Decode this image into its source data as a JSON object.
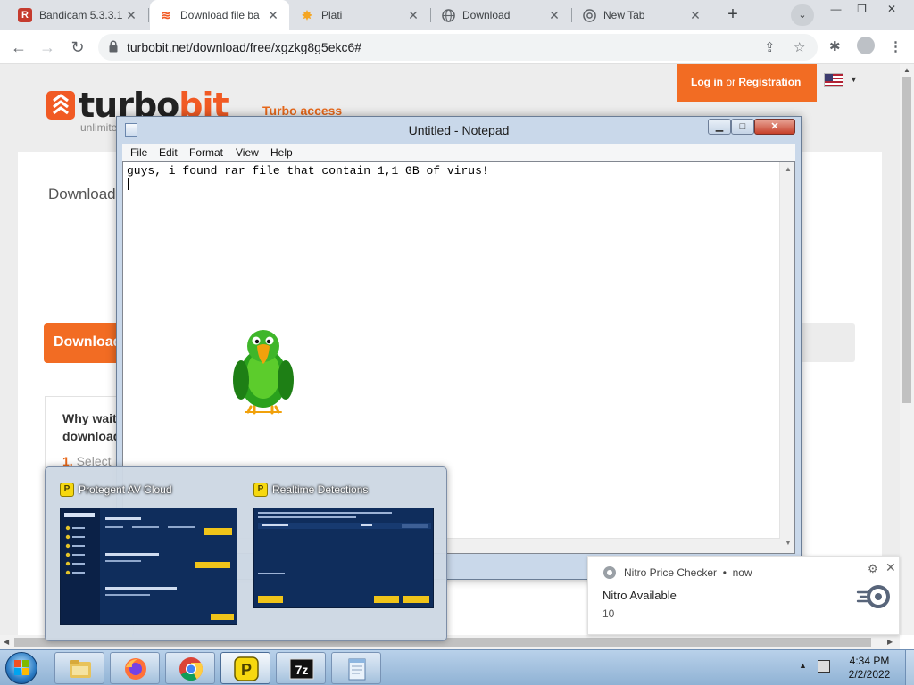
{
  "browser": {
    "tabs": [
      {
        "title": "Bandicam 5.3.3.1",
        "icon": "bandicam-icon",
        "active": false
      },
      {
        "title": "Download file ba",
        "icon": "turbobit-icon",
        "active": true
      },
      {
        "title": "Plati",
        "icon": "plati-icon",
        "active": false
      },
      {
        "title": "Download",
        "icon": "globe-icon",
        "active": false
      },
      {
        "title": "New Tab",
        "icon": "chrome-icon",
        "active": false
      }
    ],
    "url": "turbobit.net/download/free/xgzkg8g5ekc6#"
  },
  "page": {
    "logo": {
      "part1": "turbo",
      "part2": "bit",
      "tagline": "unlimite"
    },
    "turbo_access": "Turbo access",
    "login": {
      "login_link": "Log in",
      "or": "or",
      "register_link": "Registration"
    },
    "download_heading": "Download",
    "download_button": "Download",
    "why_text_line1": "Why wait",
    "why_text_line2": "download",
    "step_number": "1.",
    "step_text": "Select"
  },
  "notepad": {
    "title": "Untitled - Notepad",
    "menu": [
      "File",
      "Edit",
      "Format",
      "View",
      "Help"
    ],
    "text": "guys, i found rar file that contain 1,1 GB of virus!"
  },
  "thumbnails": [
    {
      "label": "Protegent AV Cloud"
    },
    {
      "label": "Realtime Detections"
    }
  ],
  "notification": {
    "app": "Nitro Price Checker",
    "time": "now",
    "title": "Nitro Available",
    "body": "10"
  },
  "taskbar": {
    "apps": [
      "file-explorer",
      "firefox",
      "chrome",
      "protegent",
      "7-zip",
      "notepad"
    ],
    "time": "4:34 PM",
    "date": "2/2/2022"
  },
  "colors": {
    "accent_orange": "#f26c23",
    "notepad_frame": "#c9d8ea",
    "taskbar": "#b9d1ea"
  }
}
